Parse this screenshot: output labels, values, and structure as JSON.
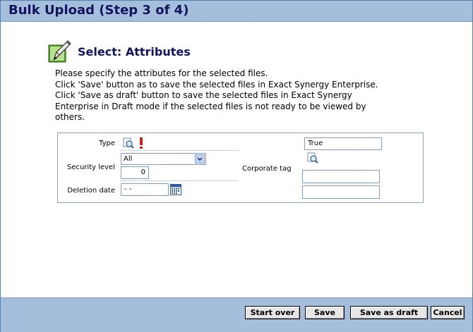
{
  "window": {
    "title": "Bulk Upload (Step 3 of 4)"
  },
  "heading": {
    "title": "Select: Attributes",
    "icon": "edit-pencil-icon"
  },
  "intro": [
    "Please specify the attributes for the selected files.",
    "Click 'Save' button as to save the selected files in Exact Synergy Enterprise.",
    "Click 'Save as draft' button to save the selected files in Exact Synergy",
    "Enterprise in Draft mode if the selected files is not ready to be viewed by",
    "others."
  ],
  "form": {
    "type_label": "Type",
    "security_label": "Security level",
    "security_select_value": "All",
    "security_number_value": "0",
    "deletion_label": "Deletion date",
    "deletion_value": "- -",
    "corporate_tag_label": "Corporate tag",
    "corporate_tag_value": "True",
    "corporate_field_1": "",
    "corporate_field_2": ""
  },
  "buttons": {
    "start_over": "Start over",
    "save": "Save",
    "save_as_draft": "Save as draft",
    "cancel": "Cancel"
  },
  "colors": {
    "bar_background": "#a4bedb",
    "title_text": "#13145e",
    "required_marker": "#d11a1a"
  }
}
